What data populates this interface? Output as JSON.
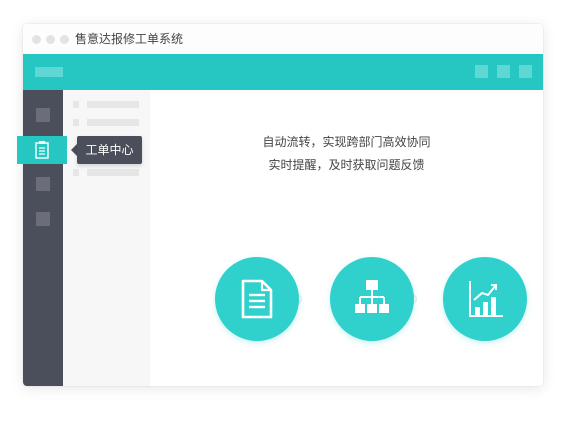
{
  "window": {
    "title": "售意达报修工单系统"
  },
  "sidebar": {
    "items": [
      {
        "icon": "placeholder-square"
      },
      {
        "icon": "clipboard-icon",
        "active": true,
        "tooltip": "工单中心"
      },
      {
        "icon": "placeholder-square"
      },
      {
        "icon": "placeholder-square"
      }
    ]
  },
  "main": {
    "headline_line1": "自动流转，实现跨部门高效协同",
    "headline_line2": "实时提醒，及时获取问题反馈",
    "steps": [
      {
        "icon": "document-icon"
      },
      {
        "icon": "org-chart-icon"
      },
      {
        "icon": "growth-chart-icon"
      }
    ]
  },
  "colors": {
    "accent": "#26c6c3",
    "circle": "#30d1cc",
    "sidebar": "#4b4e5b",
    "subnav": "#f7f7f7"
  }
}
